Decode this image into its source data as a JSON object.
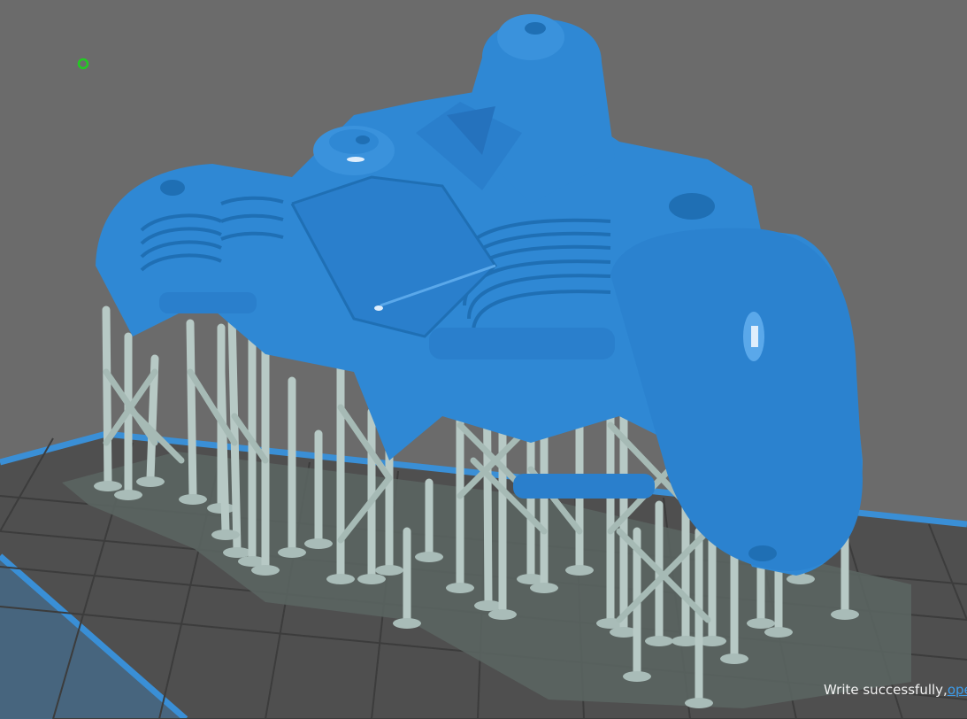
{
  "viewport": {
    "background": "#6b6b6b",
    "plate_color": "#4f4f4f",
    "plate_edge_color": "#3a8fd6",
    "grid_line_color": "#3c3c3c",
    "raft_color": "#5a6461",
    "model_color": "#2f88d4",
    "model_shade": "#2274bb",
    "model_highlight": "#5aa8ea",
    "support_color": "#b7c9c5",
    "support_shade": "#93a8a3",
    "origin_marker_color": "#22cc22"
  },
  "toast": {
    "message": "Write successfully,",
    "link": "ope"
  }
}
